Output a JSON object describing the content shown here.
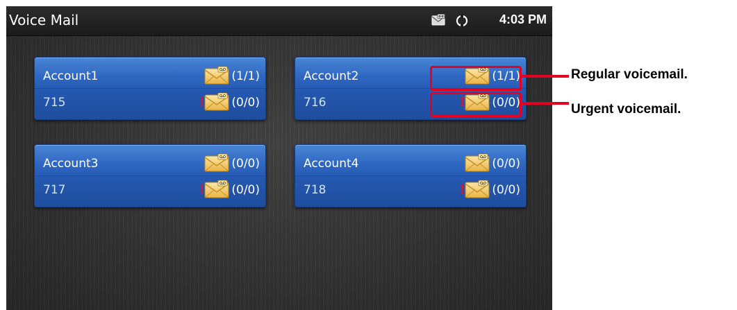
{
  "status_bar": {
    "title": "Voice Mail",
    "time": "4:03 PM"
  },
  "accounts": [
    {
      "name": "Account1",
      "number": "715",
      "regular": "(1/1)",
      "urgent": "(0/0)"
    },
    {
      "name": "Account2",
      "number": "716",
      "regular": "(1/1)",
      "urgent": "(0/0)"
    },
    {
      "name": "Account3",
      "number": "717",
      "regular": "(0/0)",
      "urgent": "(0/0)"
    },
    {
      "name": "Account4",
      "number": "718",
      "regular": "(0/0)",
      "urgent": "(0/0)"
    }
  ],
  "annotations": {
    "regular_label": "Regular voicemail.",
    "urgent_label": "Urgent voicemail."
  },
  "colors": {
    "card_blue": "#2f68c2",
    "urgent_mark": "#d4163c",
    "callout_red": "#e4001f"
  },
  "icons": [
    "voicemail-status-icon",
    "sync-icon",
    "envelope-icon",
    "urgent-exclamation-icon"
  ]
}
